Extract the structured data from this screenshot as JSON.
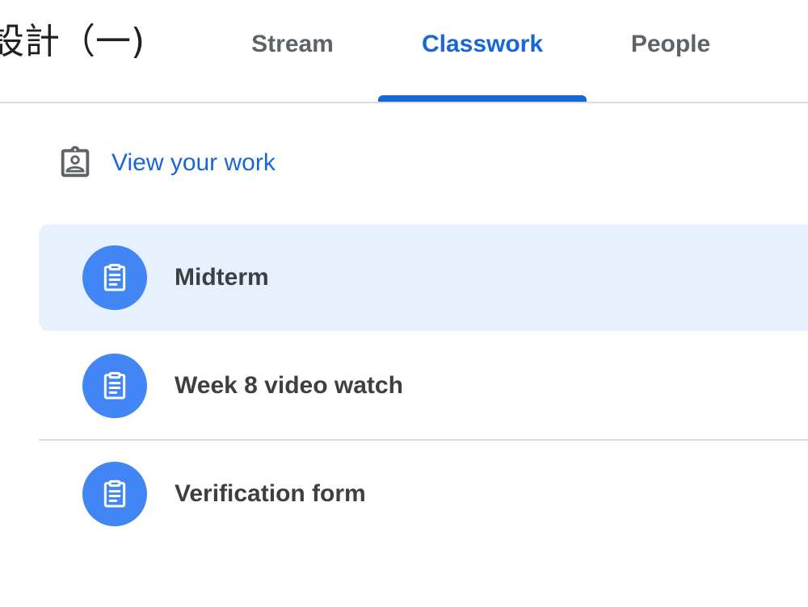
{
  "header": {
    "class_title": "設計（一)",
    "tabs": [
      {
        "label": "Stream",
        "active": false
      },
      {
        "label": "Classwork",
        "active": true
      },
      {
        "label": "People",
        "active": false
      }
    ]
  },
  "view_work": {
    "label": "View your work",
    "icon": "assignment-ind-icon"
  },
  "classwork_items": [
    {
      "title": "Midterm",
      "icon": "assignment-icon",
      "selected": true
    },
    {
      "title": "Week 8 video watch",
      "icon": "assignment-icon",
      "selected": false
    },
    {
      "title": "Verification form",
      "icon": "assignment-icon",
      "selected": false
    }
  ],
  "colors": {
    "accent": "#1967d2",
    "icon_circle": "#4285f4",
    "selected_bg": "#e8f0fe",
    "divider": "#dadce0",
    "text_primary": "#3c4043",
    "text_secondary": "#5f6368"
  }
}
